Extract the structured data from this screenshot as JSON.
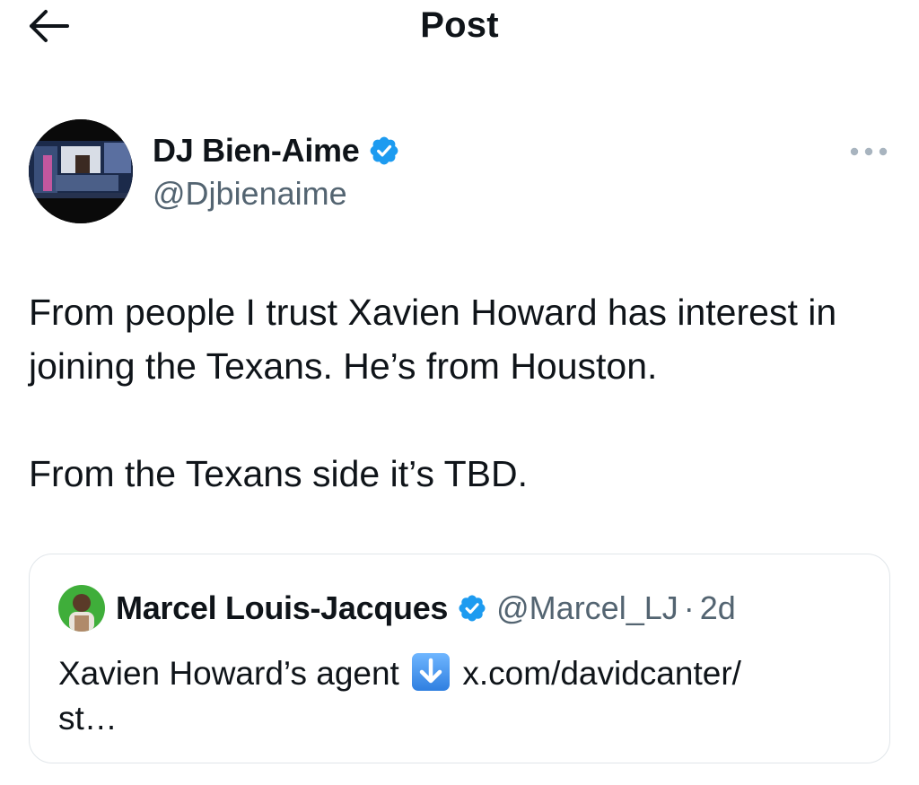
{
  "header": {
    "title": "Post",
    "back_icon": "arrow-left-icon"
  },
  "author": {
    "name": "DJ Bien-Aime",
    "handle": "@Djbienaime",
    "verified": true,
    "verified_color": "#1d9bf0"
  },
  "post": {
    "paragraphs": [
      "From people I trust Xavien Howard has interest in joining the Texans. He’s from Houston.",
      "From the Texans side it’s TBD."
    ]
  },
  "quoted_post": {
    "name": "Marcel Louis-Jacques",
    "handle": "@Marcel_LJ",
    "separator": "·",
    "time": "2d",
    "text_before": "Xavien Howard’s agent",
    "emoji": "down-arrow-emoji",
    "link_text": "x.com/davidcanter/",
    "text_after": "st…"
  },
  "colors": {
    "text_primary": "#0f1419",
    "text_secondary": "#536471",
    "verified_blue": "#1d9bf0",
    "card_border": "#e1e6ea"
  }
}
